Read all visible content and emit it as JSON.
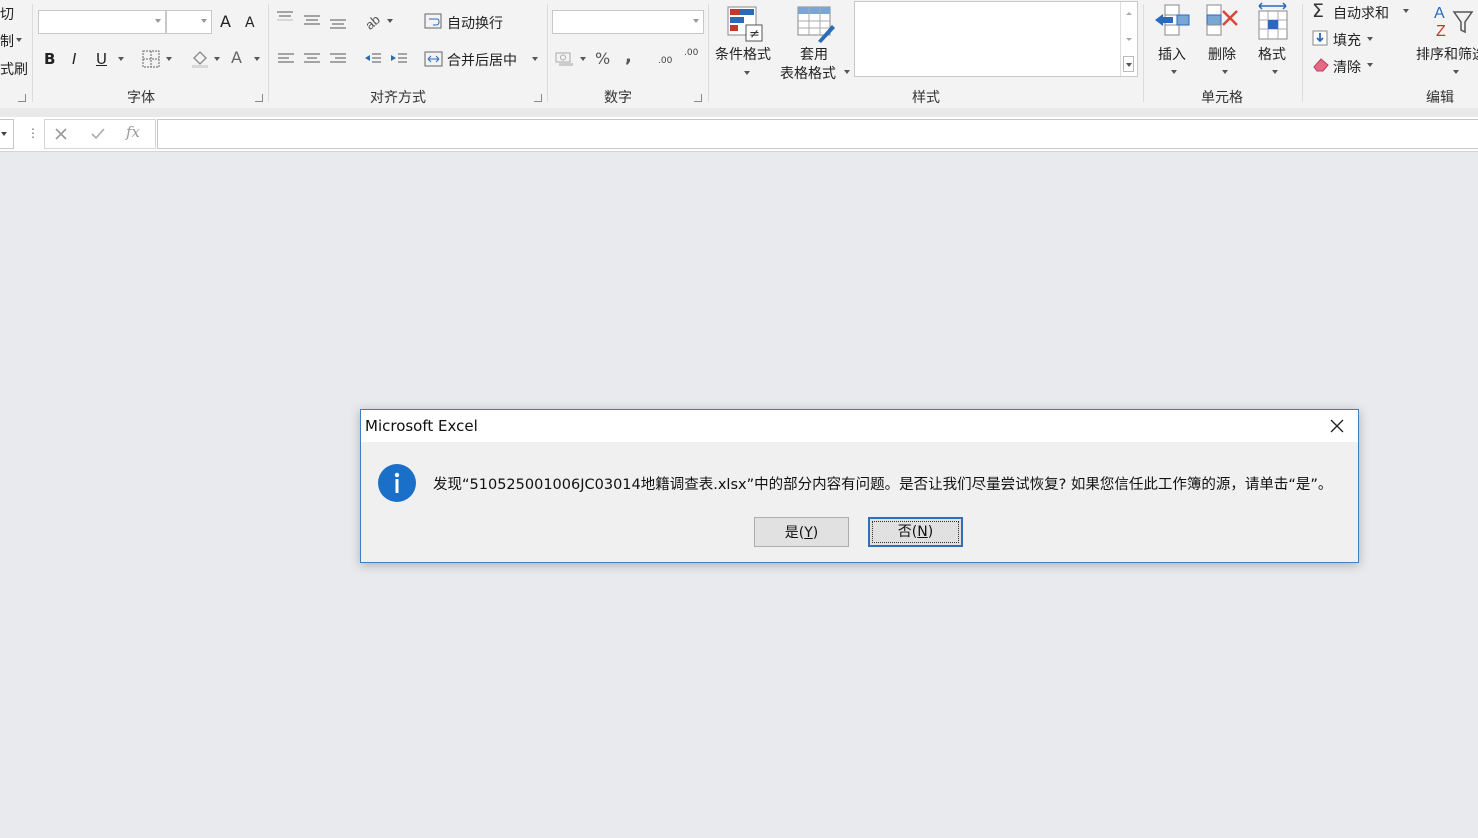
{
  "ribbon": {
    "clipboard_fragments": [
      "切",
      "制",
      "式刷"
    ],
    "font_group": "字体",
    "alignment_group": "对齐方式",
    "number_group": "数字",
    "styles_group": "样式",
    "cells_group": "单元格",
    "editing_group": "编辑",
    "bold": "B",
    "italic": "I",
    "underline": "U",
    "grow_font": "A",
    "shrink_font": "A",
    "font_color": "A",
    "wrap_text": "自动换行",
    "merge_center": "合并后居中",
    "percent": "%",
    "comma": ",",
    "inc_decimal": ".00",
    "dec_decimal": ".00",
    "conditional_format": "条件格式",
    "table_format_line1": "套用",
    "table_format_line2": "表格格式",
    "insert": "插入",
    "delete": "删除",
    "format": "格式",
    "autosum": "自动求和",
    "fill": "填充",
    "clear": "清除",
    "sort_filter": "排序和筛选"
  },
  "formula_bar": {
    "fx": "fx",
    "value": ""
  },
  "dialog": {
    "title": "Microsoft Excel",
    "message": "发现“510525001006JC03014地籍调查表.xlsx”中的部分内容有问题。是否让我们尽量尝试恢复? 如果您信任此工作簿的源，请单击“是”。",
    "yes_text": "是(",
    "yes_key": "Y",
    "no_text": "否(",
    "no_key": "N",
    "paren_close": ")"
  },
  "colors": {
    "accent": "#1a6fc9",
    "dialog_border": "#3c7fc2"
  }
}
